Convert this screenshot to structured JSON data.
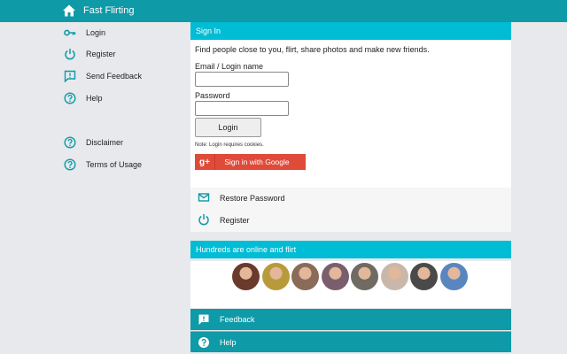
{
  "app": {
    "title": "Fast Flirting"
  },
  "sidebar": {
    "items": [
      {
        "label": "Login",
        "icon": "key-icon"
      },
      {
        "label": "Register",
        "icon": "power-icon"
      },
      {
        "label": "Send Feedback",
        "icon": "feedback-icon"
      },
      {
        "label": "Help",
        "icon": "help-icon"
      },
      {
        "label": "Disclaimer",
        "icon": "help-icon"
      },
      {
        "label": "Terms of Usage",
        "icon": "help-icon"
      }
    ]
  },
  "signin": {
    "header": "Sign In",
    "intro": "Find people close to you, flirt, share photos and make new friends.",
    "email_label": "Email / Login name",
    "email_value": "",
    "password_label": "Password",
    "password_value": "",
    "login_button": "Login",
    "note": "Note: Login requires cookies.",
    "google_icon": "g+",
    "google_button": "Sign in with Google"
  },
  "secondary": {
    "items": [
      {
        "label": "Restore Password",
        "icon": "mail-icon"
      },
      {
        "label": "Register",
        "icon": "power-icon"
      }
    ]
  },
  "online": {
    "header": "Hundreds are online and flirt",
    "avatar_colors": [
      "#6a3a2c",
      "#b89a3a",
      "#8a6b5a",
      "#7a5e6e",
      "#6f6a62",
      "#c9b8aa",
      "#4a4a4a",
      "#5a86c0"
    ]
  },
  "footer": {
    "items": [
      {
        "label": "Feedback",
        "icon": "feedback-icon"
      },
      {
        "label": "Help",
        "icon": "help-icon"
      }
    ]
  },
  "colors": {
    "teal": "#0e9aa7",
    "cyan": "#00bcd4",
    "google_red": "#e04a39"
  }
}
